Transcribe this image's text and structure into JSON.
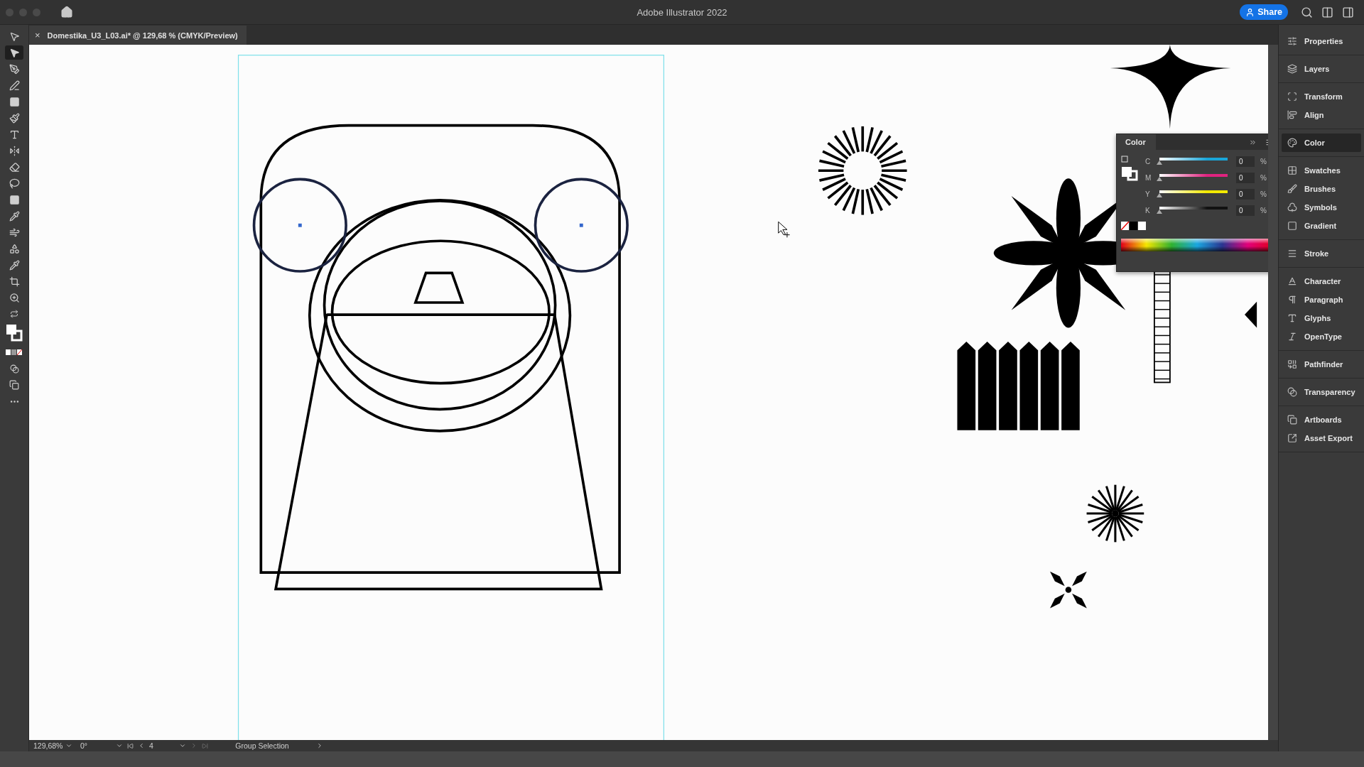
{
  "app": {
    "title": "Adobe Illustrator 2022",
    "share": "Share"
  },
  "document_tab": {
    "close": "×",
    "label": "Domestika_U3_L03.ai* @ 129,68 % (CMYK/Preview)"
  },
  "tools": [
    {
      "selected": false
    },
    {
      "selected": true
    },
    {
      "selected": false
    },
    {
      "selected": false
    },
    {
      "selected": false
    },
    {
      "selected": false
    },
    {
      "selected": false
    },
    {
      "selected": false
    },
    {
      "selected": false
    },
    {
      "selected": false
    },
    {
      "selected": false
    },
    {
      "selected": false
    },
    {
      "selected": false
    },
    {
      "selected": false
    },
    {
      "selected": false
    },
    {
      "selected": false
    },
    {
      "selected": false
    }
  ],
  "panel_groups": [
    {
      "items": [
        {
          "label": "Properties",
          "selected": false
        }
      ]
    },
    {
      "items": [
        {
          "label": "Layers",
          "selected": false
        }
      ]
    },
    {
      "items": [
        {
          "label": "Transform",
          "selected": false
        },
        {
          "label": "Align",
          "selected": false
        }
      ]
    },
    {
      "items": [
        {
          "label": "Color",
          "selected": true
        }
      ]
    },
    {
      "items": [
        {
          "label": "Swatches",
          "selected": false
        },
        {
          "label": "Brushes",
          "selected": false
        },
        {
          "label": "Symbols",
          "selected": false
        },
        {
          "label": "Gradient",
          "selected": false
        }
      ]
    },
    {
      "items": [
        {
          "label": "Stroke",
          "selected": false
        }
      ]
    },
    {
      "items": [
        {
          "label": "Character",
          "selected": false
        },
        {
          "label": "Paragraph",
          "selected": false
        },
        {
          "label": "Glyphs",
          "selected": false
        },
        {
          "label": "OpenType",
          "selected": false
        }
      ]
    },
    {
      "items": [
        {
          "label": "Pathfinder",
          "selected": false
        }
      ]
    },
    {
      "items": [
        {
          "label": "Transparency",
          "selected": false
        }
      ]
    },
    {
      "items": [
        {
          "label": "Artboards",
          "selected": false
        },
        {
          "label": "Asset Export",
          "selected": false
        }
      ]
    }
  ],
  "color_panel": {
    "title": "Color",
    "channels": [
      {
        "label": "C",
        "value": "0",
        "unit": "%",
        "level": 0,
        "color": "#1aa6d9"
      },
      {
        "label": "M",
        "value": "0",
        "unit": "%",
        "level": 0,
        "color": "#e0237f"
      },
      {
        "label": "Y",
        "value": "0",
        "unit": "%",
        "level": 0,
        "color": "#f2e900"
      },
      {
        "label": "K",
        "value": "0",
        "unit": "%",
        "level": 0,
        "color": "#111111"
      }
    ]
  },
  "status_bar": {
    "zoom": "129,68%",
    "rotation": "0°",
    "artboard": "4",
    "tool": "Group Selection"
  }
}
